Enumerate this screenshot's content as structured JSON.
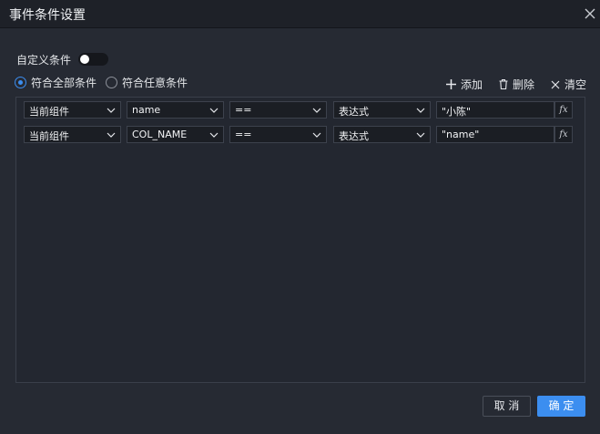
{
  "dialog": {
    "title": "事件条件设置"
  },
  "custom_condition": {
    "label": "自定义条件",
    "enabled": false
  },
  "match_mode": {
    "options": [
      {
        "label": "符合全部条件",
        "checked": true
      },
      {
        "label": "符合任意条件",
        "checked": false
      }
    ]
  },
  "toolbar": {
    "add_label": "添加",
    "delete_label": "删除",
    "clear_label": "清空"
  },
  "conditions": [
    {
      "scope": "当前组件",
      "field": "name",
      "operator": "==",
      "value_type": "表达式",
      "value": "\"小陈\"",
      "fx": "fx"
    },
    {
      "scope": "当前组件",
      "field": "COL_NAME",
      "operator": "==",
      "value_type": "表达式",
      "value": "\"name\"",
      "fx": "fx"
    }
  ],
  "footer": {
    "cancel_label": "取 消",
    "ok_label": "确 定"
  },
  "colors": {
    "accent": "#3c8ef0",
    "background": "#262a33",
    "panel_border": "#3a3f4a"
  }
}
